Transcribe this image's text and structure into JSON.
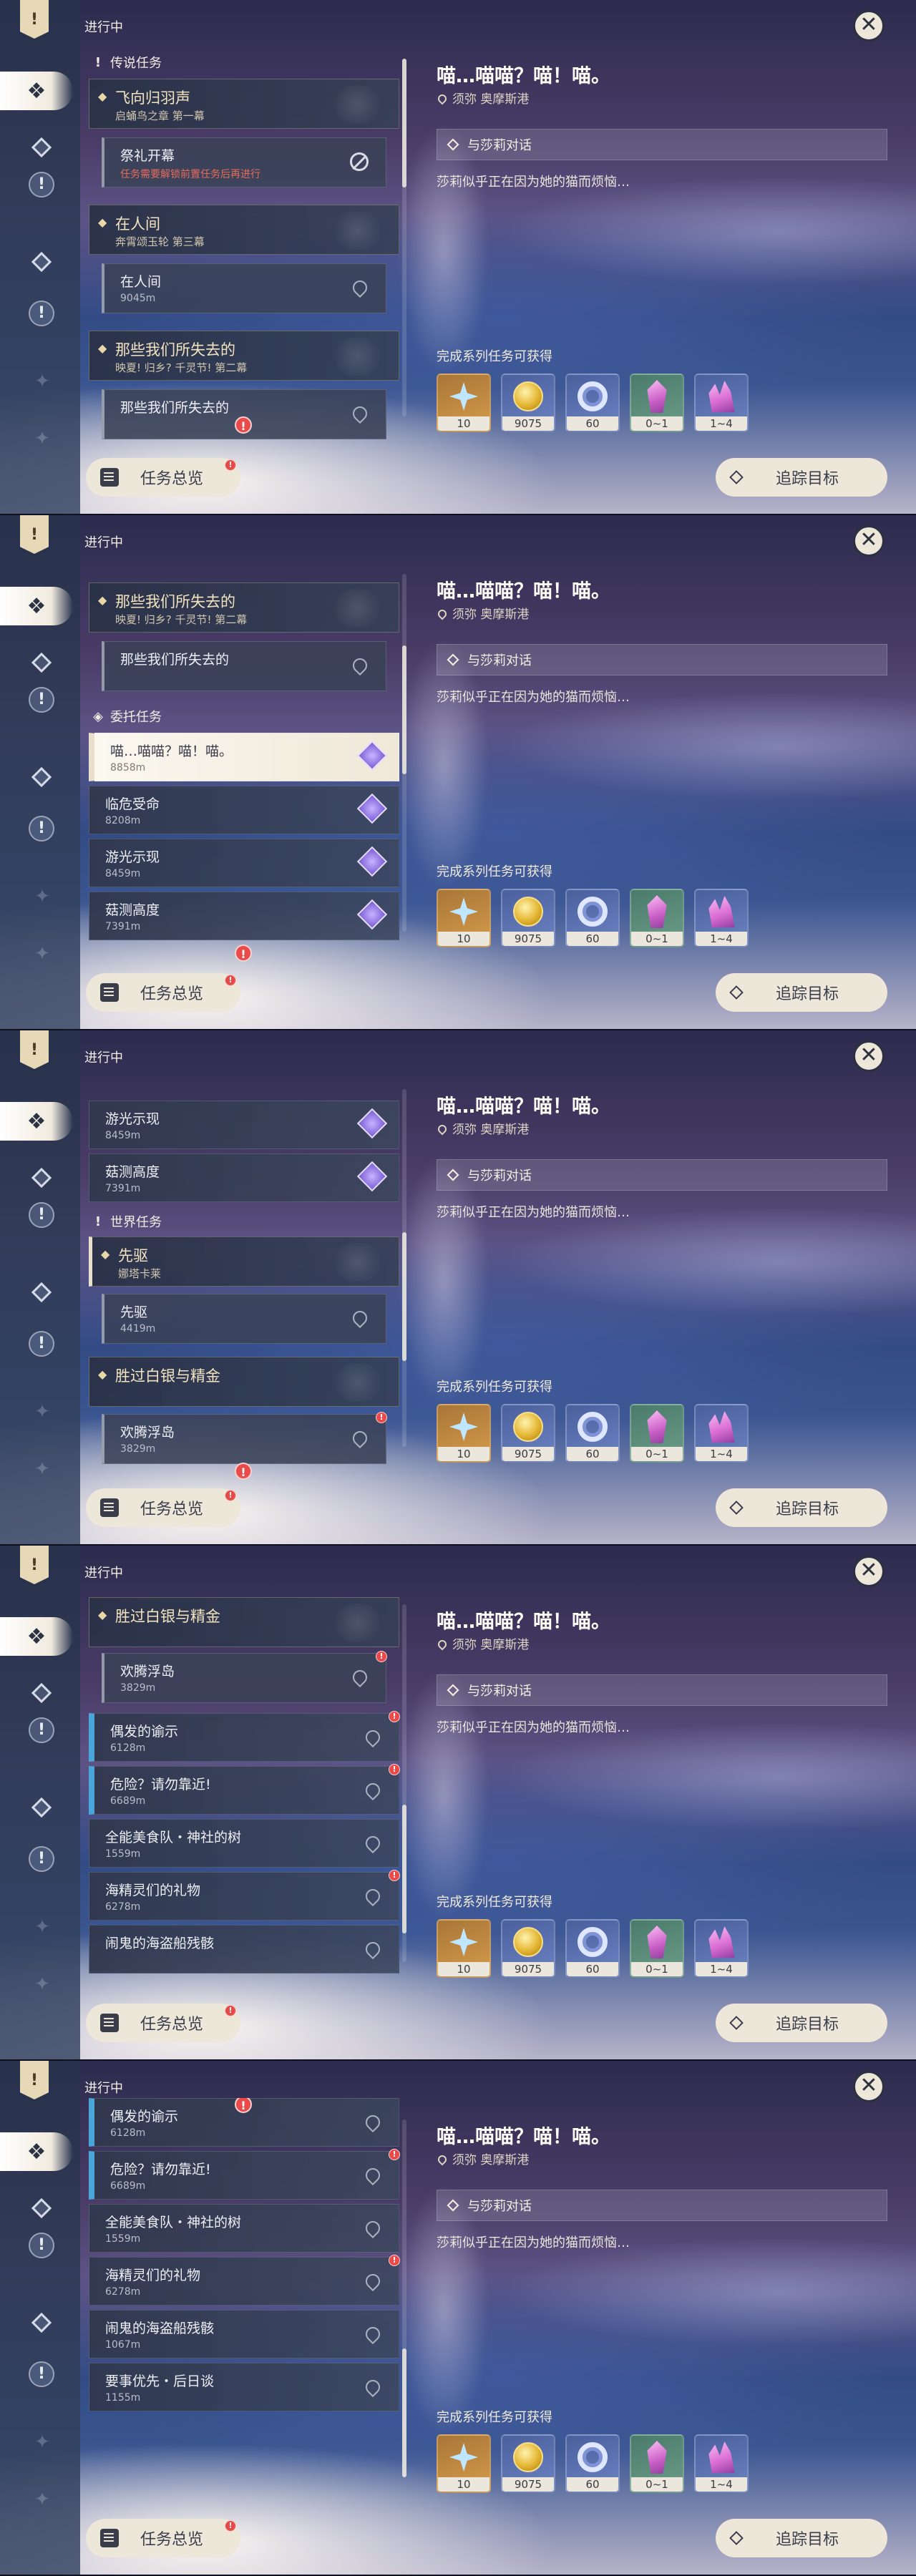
{
  "common": {
    "status": "进行中",
    "overview_label": "任务总览",
    "track_label": "追踪目标",
    "close_symbol": "✕",
    "quest_title": "喵…喵喵？喵！喵。",
    "quest_location": "须弥 奥摩斯港",
    "objective": "与莎莉对话",
    "description": "莎莉似乎正在因为她的猫而烦恼…",
    "rewards_label": "完成系列任务可获得",
    "rewards": [
      {
        "name": "primogem-icon",
        "count": "10",
        "color": "#c68a3e"
      },
      {
        "name": "mora-icon",
        "count": "9075",
        "color": "#5a6fae"
      },
      {
        "name": "exp-icon",
        "count": "60",
        "color": "#5a6fae"
      },
      {
        "name": "crystal-icon",
        "count": "0~1",
        "color": "#5a8c7a"
      },
      {
        "name": "crystal-cluster-icon",
        "count": "1~4",
        "color": "#5a6fae"
      }
    ]
  },
  "panels": [
    {
      "sections": [
        "传说任务"
      ],
      "groups": [
        {
          "title": "飞向归羽声",
          "sub": "启蛹鸟之章 第一幕"
        },
        {
          "title": "在人间",
          "sub": "奔霄颂玉轮 第三幕"
        },
        {
          "title": "那些我们所失去的",
          "sub": "映夏! 归乡? 千灵节! 第二幕"
        }
      ],
      "subs": [
        {
          "title": "祭礼开幕",
          "note": "任务需要解锁前置任务后再进行"
        },
        {
          "title": "在人间",
          "note": "9045m"
        },
        {
          "title": "那些我们所失去的",
          "note": ""
        }
      ]
    },
    {
      "sections": [
        "委托任务"
      ],
      "groups": [
        {
          "title": "那些我们所失去的",
          "sub": "映夏! 归乡? 千灵节! 第二幕"
        }
      ],
      "subs": [
        {
          "title": "那些我们所失去的",
          "note": ""
        }
      ],
      "items": [
        {
          "title": "喵…喵喵？喵！喵。",
          "note": "8858m"
        },
        {
          "title": "临危受命",
          "note": "8208m"
        },
        {
          "title": "游光示现",
          "note": "8459m"
        },
        {
          "title": "菇测高度",
          "note": "7391m"
        }
      ]
    },
    {
      "sections": [
        "世界任务"
      ],
      "items": [
        {
          "title": "游光示现",
          "note": "8459m"
        },
        {
          "title": "菇测高度",
          "note": "7391m"
        }
      ],
      "groups": [
        {
          "title": "先驱",
          "sub": "娜塔卡莱"
        },
        {
          "title": "胜过白银与精金",
          "sub": ""
        }
      ],
      "subs": [
        {
          "title": "先驱",
          "note": "4419m"
        },
        {
          "title": "欢腾浮岛",
          "note": "3829m"
        }
      ]
    },
    {
      "groups": [
        {
          "title": "胜过白银与精金",
          "sub": ""
        }
      ],
      "subs": [
        {
          "title": "欢腾浮岛",
          "note": "3829m"
        }
      ],
      "items": [
        {
          "title": "偶发的谕示",
          "note": "6128m"
        },
        {
          "title": "危险？请勿靠近!",
          "note": "6689m"
        },
        {
          "title": "全能美食队・神社的树",
          "note": "1559m"
        },
        {
          "title": "海精灵们的礼物",
          "note": "6278m"
        },
        {
          "title": "闹鬼的海盗船残骸",
          "note": ""
        }
      ]
    },
    {
      "items": [
        {
          "title": "偶发的谕示",
          "note": "6128m"
        },
        {
          "title": "危险？请勿靠近!",
          "note": "6689m"
        },
        {
          "title": "全能美食队・神社的树",
          "note": "1559m"
        },
        {
          "title": "海精灵们的礼物",
          "note": "6278m"
        },
        {
          "title": "闹鬼的海盗船残骸",
          "note": "1067m"
        },
        {
          "title": "要事优先・后日谈",
          "note": "1155m"
        }
      ]
    }
  ]
}
